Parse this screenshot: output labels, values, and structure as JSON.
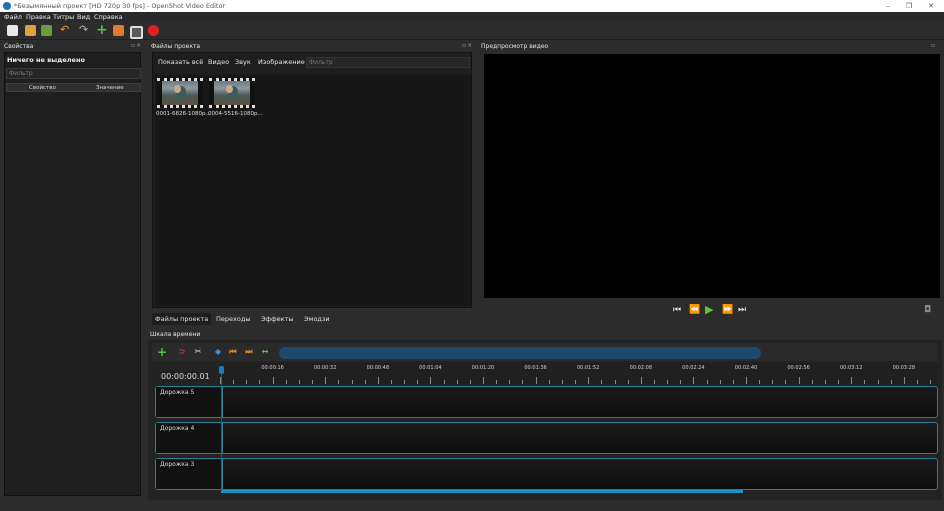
{
  "window": {
    "title": "*Безымянный проект [HD 720p 30 fps] - OpenShot Video Editor",
    "controls": [
      "–",
      "❐",
      "✕"
    ]
  },
  "menu": [
    "Файл",
    "Правка",
    "Титры",
    "Вид",
    "Справка"
  ],
  "toolbar_icons": [
    "new-project-icon",
    "open-project-icon",
    "save-project-icon",
    "undo-icon",
    "redo-icon",
    "import-files-icon",
    "choose-profile-icon",
    "fullscreen-icon",
    "export-video-icon"
  ],
  "properties": {
    "title": "Свойства",
    "header": "Ничего не выделено",
    "filter_placeholder": "Фильтр",
    "col_property": "Свойство",
    "col_value": "Значение"
  },
  "project_files": {
    "title": "Файлы проекта",
    "filter_tabs": [
      "Показать всё",
      "Видео",
      "Звук",
      "Изображение"
    ],
    "filter_placeholder": "Фильтр",
    "files": [
      {
        "name": "0001-6826-1080p..."
      },
      {
        "name": "0004-5516-1080p..."
      }
    ],
    "bottom_tabs": [
      "Файлы проекта",
      "Переходы",
      "Эффекты",
      "Эмодзи"
    ]
  },
  "preview": {
    "title": "Предпросмотр видео",
    "controls": [
      "⏮",
      "⏪",
      "▶",
      "⏩",
      "⏭"
    ]
  },
  "timeline": {
    "title": "Шкала времени",
    "current_time": "00:00:00.01",
    "ruler_labels": [
      "00:00:16",
      "00:00:32",
      "00:00:48",
      "00:01:04",
      "00:01:20",
      "00:01:36",
      "00:01:52",
      "00:02:08",
      "00:02:24",
      "00:02:40",
      "00:02:56",
      "00:03:12",
      "00:03:28"
    ],
    "tracks": [
      "Дорожка 5",
      "Дорожка 4",
      "Дорожка 3"
    ],
    "colors": {
      "accent": "#1f8fc0",
      "playhead": "#d02020"
    }
  }
}
